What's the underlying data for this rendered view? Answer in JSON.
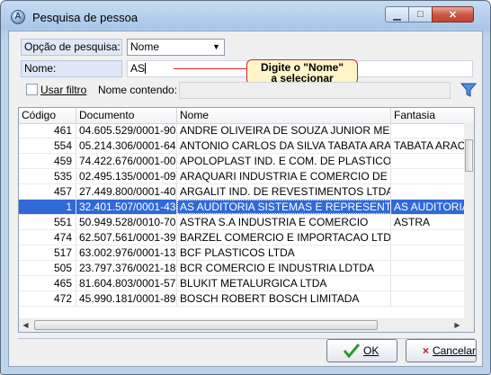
{
  "window": {
    "title": "Pesquisa de pessoa",
    "minimize": "▁",
    "maximize": "□",
    "close": "✕"
  },
  "search": {
    "opcao_label": "Opção de pesquisa:",
    "opcao_value": "Nome",
    "nome_label": "Nome:",
    "nome_value": "AS",
    "callout_line1": "Digite o \"Nome\"",
    "callout_line2": "a selecionar",
    "usar_filtro_label": "Usar filtro",
    "nome_contendo_label": "Nome contendo:",
    "nome_contendo_value": "",
    "filter_icon": "funnel-icon"
  },
  "grid": {
    "columns": [
      "Código",
      "Documento",
      "Nome",
      "Fantasia"
    ],
    "rows": [
      {
        "codigo": "461",
        "documento": "04.605.529/0001-90",
        "nome": "ANDRE OLIVEIRA DE SOUZA JUNIOR ME",
        "fantasia": ""
      },
      {
        "codigo": "554",
        "documento": "05.214.306/0001-64",
        "nome": "ANTONIO CARLOS DA SILVA TABATA ARACAT",
        "fantasia": "TABATA ARACA"
      },
      {
        "codigo": "459",
        "documento": "74.422.676/0001-00",
        "nome": "APOLOPLAST IND. E COM. DE PLASTICO LTDA",
        "fantasia": ""
      },
      {
        "codigo": "535",
        "documento": "02.495.135/0001-09",
        "nome": "ARAQUARI INDUSTRIA E COMERCIO DE FIBRA",
        "fantasia": ""
      },
      {
        "codigo": "457",
        "documento": "27.449.800/0001-40",
        "nome": "ARGALIT IND. DE REVESTIMENTOS LTDA",
        "fantasia": ""
      },
      {
        "codigo": "1",
        "documento": "32.401.507/0001-43",
        "nome": "AS AUDITORIA SISTEMAS E REPRESENTAÇÕES",
        "fantasia": "AS AUDITORIA S",
        "selected": true
      },
      {
        "codigo": "551",
        "documento": "50.949.528/0010-70",
        "nome": "ASTRA S.A INDUSTRIA E COMERCIO",
        "fantasia": "ASTRA"
      },
      {
        "codigo": "474",
        "documento": "62.507.561/0001-39",
        "nome": "BARZEL COMERCIO E IMPORTACAO LTDA",
        "fantasia": ""
      },
      {
        "codigo": "517",
        "documento": "63.002.976/0001-13",
        "nome": "BCF PLASTICOS LTDA",
        "fantasia": ""
      },
      {
        "codigo": "505",
        "documento": "23.797.376/0021-18",
        "nome": "BCR COMERCIO E INDUSTRIA LDTDA",
        "fantasia": ""
      },
      {
        "codigo": "465",
        "documento": "81.604.803/0001-57",
        "nome": "BLUKIT METALURGICA LTDA",
        "fantasia": ""
      },
      {
        "codigo": "472",
        "documento": "45.990.181/0001-89",
        "nome": "BOSCH ROBERT BOSCH LIMITADA",
        "fantasia": ""
      }
    ]
  },
  "actions": {
    "ok_label": "OK",
    "cancel_label": "Cancelar"
  },
  "colors": {
    "selection": "#2f6ad6",
    "callout_border": "#c8262c",
    "callout_fill": "#fff5c8",
    "ok_check": "#2e9a2e",
    "cancel_x": "#c4262c"
  }
}
